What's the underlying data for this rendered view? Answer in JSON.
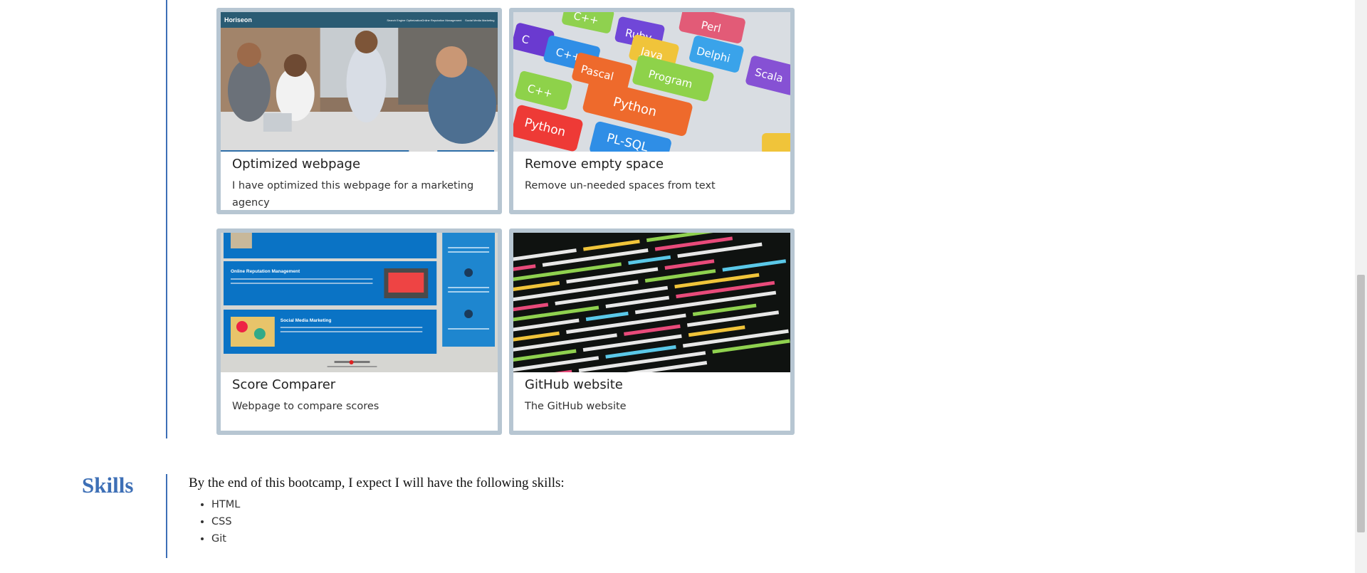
{
  "projects": [
    {
      "title": "Optimized webpage",
      "description": "I have optimized this webpage for a marketing agency",
      "thumb_header": "Horiseon",
      "thumb_nav": [
        "Search Engine Optimization",
        "Online Reputation Management",
        "Social Media Marketing"
      ]
    },
    {
      "title": "Remove empty space",
      "description": "Remove un-needed spaces from text",
      "thumb_keys": [
        "C++",
        "Ruby",
        "Perl",
        "C",
        "C++",
        "Java",
        "Delphi",
        "Pascal",
        "Program",
        "Scala",
        "C++",
        "Python",
        "Python",
        "PL-SQL"
      ]
    },
    {
      "title": "Score Comparer",
      "description": "Webpage to compare scores",
      "thumb_sections": [
        "Online Reputation Management",
        "Social Media Marketing"
      ]
    },
    {
      "title": "GitHub website",
      "description": "The GitHub website"
    }
  ],
  "skills": {
    "heading": "Skills",
    "intro": "By the end of this bootcamp, I expect I will have the following skills:",
    "items": [
      "HTML",
      "CSS",
      "Git"
    ]
  },
  "colors": {
    "accent": "#3d6fb6",
    "card_border": "#b7c6d2"
  }
}
